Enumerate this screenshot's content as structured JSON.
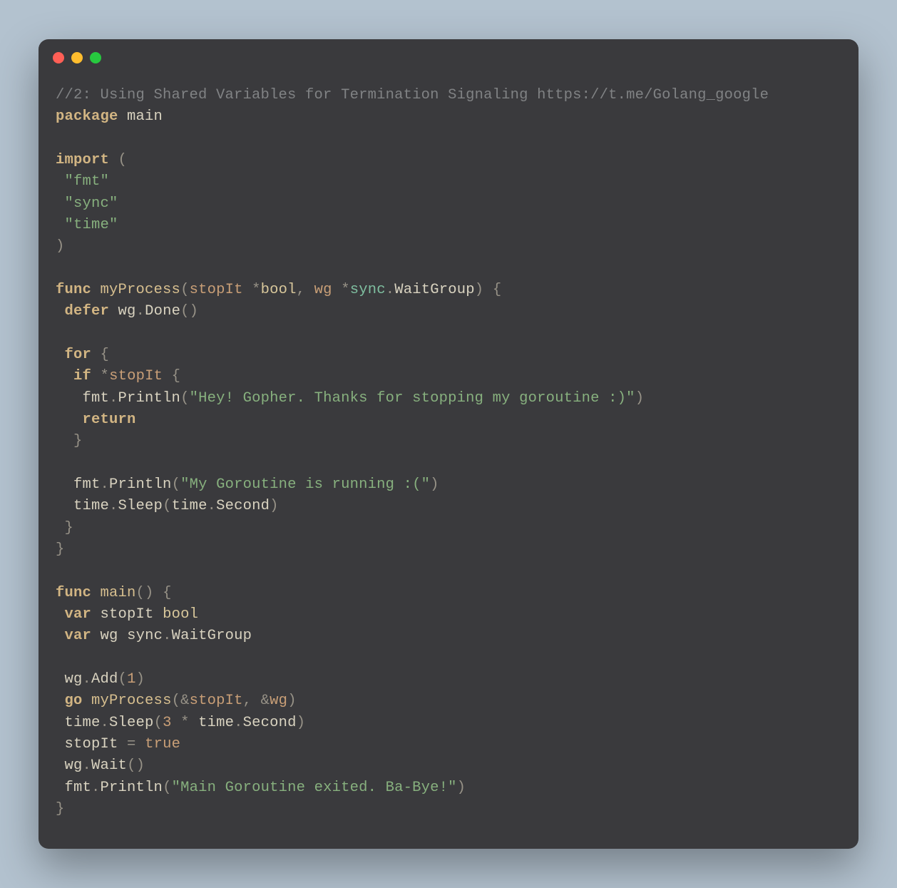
{
  "colors": {
    "background": "#b3c2cf",
    "window": "#3a3a3d",
    "dot_red": "#ff5f56",
    "dot_yellow": "#ffbd2e",
    "dot_green": "#27c93f",
    "text": "#d9d3c0",
    "comment": "#808284",
    "keyword": "#d2b583",
    "string": "#87b07e",
    "number": "#c99f77"
  },
  "code": {
    "comment1": "//2: Using Shared Variables for Termination Signaling https://t.me/Golang_google",
    "kw_package": "package",
    "pkg_main": "main",
    "kw_import": "import",
    "paren_open": "(",
    "imp_fmt": "\"fmt\"",
    "imp_sync": "\"sync\"",
    "imp_time": "\"time\"",
    "paren_close": ")",
    "kw_func": "func",
    "fn_myProcess": "myProcess",
    "p_stopIt": "stopIt",
    "star": "*",
    "t_bool": "bool",
    "comma": ",",
    "p_wg": "wg",
    "t_sync": "sync",
    "dot": ".",
    "t_WaitGroup": "WaitGroup",
    "brace_open": "{",
    "brace_close": "}",
    "kw_defer": "defer",
    "id_wg": "wg",
    "m_Done": "Done",
    "call": "()",
    "kw_for": "for",
    "kw_if": "if",
    "id_stopIt": "stopIt",
    "id_fmt": "fmt",
    "m_Println": "Println",
    "str1": "\"Hey! Gopher. Thanks for stopping my goroutine :)\"",
    "kw_return": "return",
    "str2": "\"My Goroutine is running :(\"",
    "id_time": "time",
    "m_Sleep": "Sleep",
    "m_Second": "Second",
    "fn_main": "main",
    "kw_var": "var",
    "m_Add": "Add",
    "num1": "1",
    "kw_go": "go",
    "amp": "&",
    "num3": "3",
    "eq": "=",
    "lit_true": "true",
    "m_Wait": "Wait",
    "str3": "\"Main Goroutine exited. Ba-Bye!\""
  }
}
